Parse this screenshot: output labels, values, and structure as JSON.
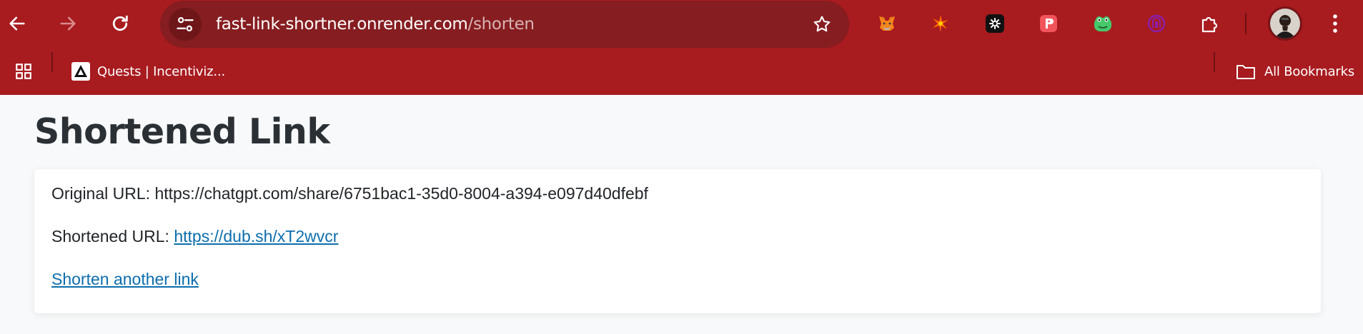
{
  "browser": {
    "address_bar": {
      "url_host": "fast-link-shortner.onrender.com",
      "url_path": "/shorten"
    },
    "extensions": [
      {
        "name": "metamask-icon"
      },
      {
        "name": "sparkle-extension-icon"
      },
      {
        "name": "dark-extension-icon"
      },
      {
        "name": "red-p-extension-icon"
      },
      {
        "name": "frog-extension-icon"
      },
      {
        "name": "purple-extension-icon"
      },
      {
        "name": "puzzle-icon"
      }
    ],
    "bookmarks_bar": {
      "items": [
        {
          "label": "Quests | Incentiviz..."
        }
      ],
      "all_bookmarks_label": "All Bookmarks"
    },
    "theme_color": "#a81b1f"
  },
  "page": {
    "title": "Shortened Link",
    "original_label": "Original URL:",
    "original_url": "https://chatgpt.com/share/6751bac1-35d0-8004-a394-e097d40dfebf",
    "shortened_label": "Shortened URL:",
    "shortened_url": "https://dub.sh/xT2wvcr",
    "shorten_another_label": "Shorten another link",
    "link_color": "#0d6ead"
  }
}
